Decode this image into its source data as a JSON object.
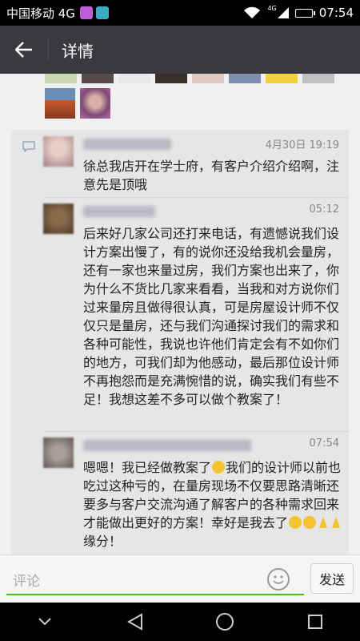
{
  "status_bar": {
    "carrier": "中国移动 4G",
    "network": "4G",
    "time": "07:54",
    "battery_level": 0.85
  },
  "toolbar": {
    "title": "详情"
  },
  "comments": [
    {
      "time": "4月30日 19:19",
      "text": "徐总我店开在学士府，有客户介绍介绍啊，注意先是顶哦"
    },
    {
      "time": "05:12",
      "text": "后来好几家公司还打来电话，有遗憾说我们设计方案出慢了，有的说你还没给我机会量房，还有一家也来量过房，我们方案也出来了，你为什么不货比几家来看看，当我和对方说你们过来量房且做得很认真，可是房屋设计师不仅仅只是量房，还与我们沟通探讨我们的需求和各种可能性，我说也许他们肯定会有不如你们的地方，可我们却为他感动，最后那位设计师不再抱怨而是充满惋惜的说，确实我们有些不足！我想这差不多可以做个教案了！"
    },
    {
      "time": "07:54",
      "text_a": "嗯嗯！我已经做教案了",
      "text_b": "我们的设计师以前也吃过这种亏的，在量房现场不仅要思路清晰还要多与客户交流沟通了解客户的各种需求回来才能做出更好的方案！幸好是我去了",
      "text_c": "缘分！"
    }
  ],
  "input": {
    "placeholder": "评论"
  },
  "send_button": {
    "label": "发送"
  },
  "colors": {
    "accent": "#45c01a",
    "toolbar": "#393a3f",
    "emoji": "#f4c430"
  },
  "icons": {
    "back": "arrow-left",
    "emoji": "smiley",
    "nav": [
      "chevron-down",
      "triangle-back",
      "circle-home",
      "square-recents"
    ]
  }
}
